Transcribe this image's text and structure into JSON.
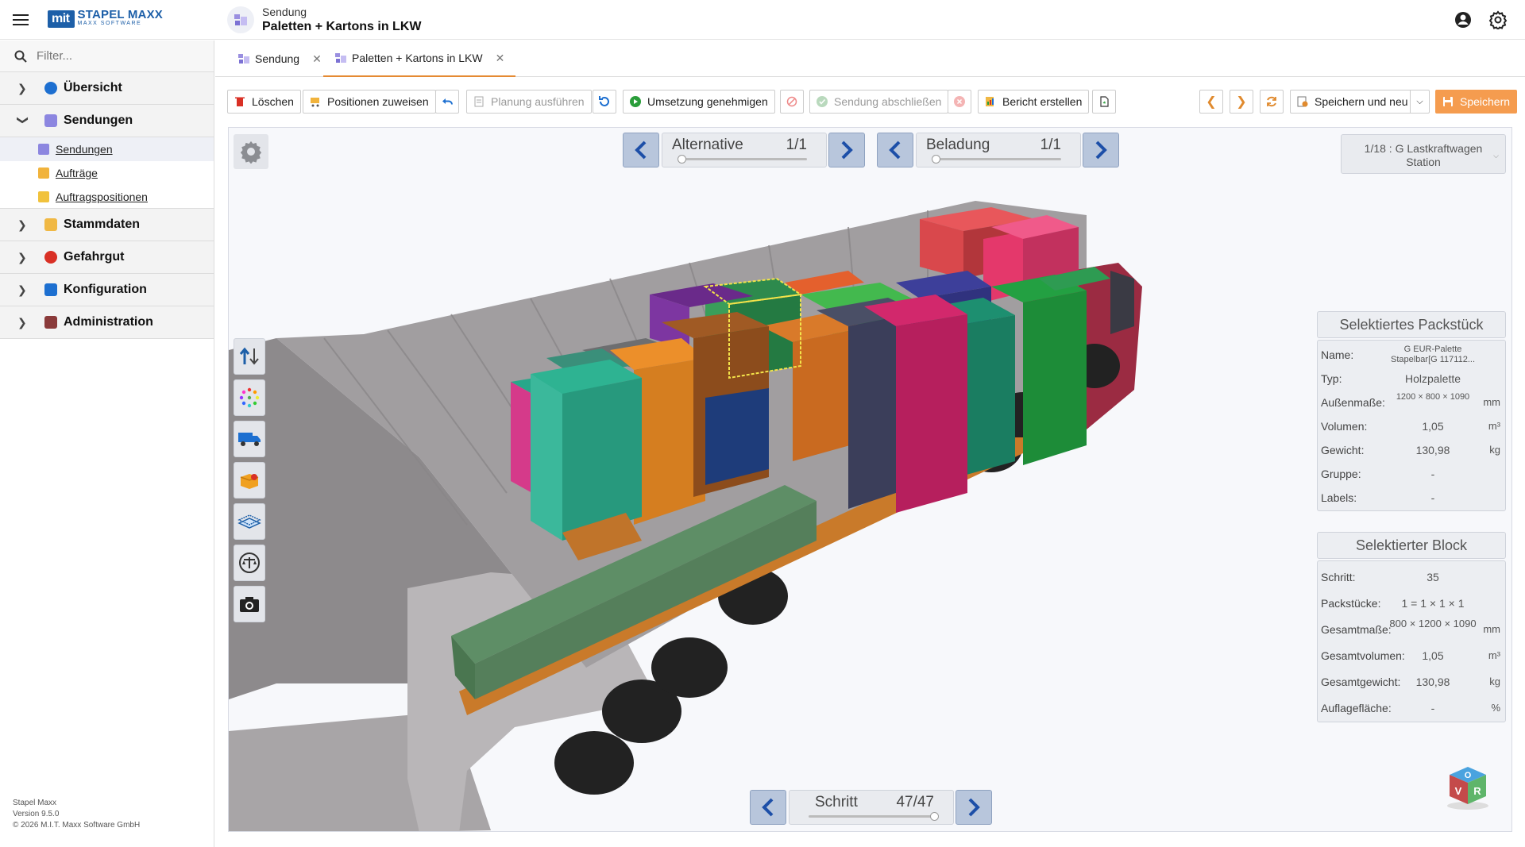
{
  "header": {
    "logo_box": "mit",
    "logo_name": "STAPEL MAXX",
    "logo_sub": "MAXX SOFTWARE",
    "breadcrumb_small": "Sendung",
    "breadcrumb_title": "Paletten + Kartons in LKW"
  },
  "sidebar": {
    "filter_placeholder": "Filter...",
    "items": [
      {
        "label": "Übersicht",
        "expanded": false,
        "icon": "globe-icon",
        "color": "#1d6fd0"
      },
      {
        "label": "Sendungen",
        "expanded": true,
        "icon": "shipment-icon",
        "color": "#6a6fd8"
      },
      {
        "label": "Stammdaten",
        "expanded": false,
        "icon": "master-data-icon",
        "color": "#e8a43a"
      },
      {
        "label": "Gefahrgut",
        "expanded": false,
        "icon": "hazard-icon",
        "color": "#d93025"
      },
      {
        "label": "Konfiguration",
        "expanded": false,
        "icon": "config-icon",
        "color": "#1d6fd0"
      },
      {
        "label": "Administration",
        "expanded": false,
        "icon": "admin-icon",
        "color": "#8a3a3a"
      }
    ],
    "sub_items": [
      {
        "label": "Sendungen",
        "active": true
      },
      {
        "label": "Aufträge",
        "active": false
      },
      {
        "label": "Auftragspositionen",
        "active": false
      }
    ],
    "footer": {
      "line1": "Stapel Maxx",
      "line2": "Version 9.5.0",
      "line3": "© 2026 M.I.T. Maxx Software GmbH"
    }
  },
  "tabs": [
    {
      "label": "Sendung",
      "active": false
    },
    {
      "label": "Paletten + Kartons in LKW",
      "active": true
    }
  ],
  "toolbar": {
    "delete": "Löschen",
    "assign_positions": "Positionen zuweisen",
    "run_planning": "Planung ausführen",
    "approve": "Umsetzung genehmigen",
    "complete": "Sendung abschließen",
    "report": "Bericht erstellen",
    "save_new": "Speichern und neu",
    "save": "Speichern",
    "accent_color": "#f59c4f"
  },
  "viewer": {
    "alternative_label": "Alternative",
    "alternative_value": "1/1",
    "loading_label": "Beladung",
    "loading_value": "1/1",
    "station_line1": "1/18 : G Lastkraftwagen",
    "station_line2": "Station",
    "step_label": "Schritt",
    "step_value": "47/47",
    "step_progress": 1.0,
    "alternative_progress": 0.0,
    "loading_progress": 0.0
  },
  "selected_package": {
    "title": "Selektiertes Packstück",
    "rows": [
      {
        "key": "Name:",
        "value": "G EUR-Palette Stapelbar[G 117112...",
        "unit": ""
      },
      {
        "key": "Typ:",
        "value": "Holzpalette",
        "unit": ""
      },
      {
        "key": "Außenmaße:",
        "value": "1200 × 800 × 1090",
        "unit": "mm"
      },
      {
        "key": "Volumen:",
        "value": "1,05",
        "unit": "m³"
      },
      {
        "key": "Gewicht:",
        "value": "130,98",
        "unit": "kg"
      },
      {
        "key": "Gruppe:",
        "value": "-",
        "unit": ""
      },
      {
        "key": "Labels:",
        "value": "-",
        "unit": ""
      }
    ]
  },
  "selected_block": {
    "title": "Selektierter Block",
    "rows": [
      {
        "key": "Schritt:",
        "value": "35",
        "unit": ""
      },
      {
        "key": "Packstücke:",
        "value": "1 = 1 × 1 × 1",
        "unit": ""
      },
      {
        "key": "Gesamtmaße:",
        "value": "800 × 1200 × 1090",
        "unit": "mm"
      },
      {
        "key": "Gesamtvolumen:",
        "value": "1,05",
        "unit": "m³"
      },
      {
        "key": "Gesamtgewicht:",
        "value": "130,98",
        "unit": "kg"
      },
      {
        "key": "Auflagefläche:",
        "value": "-",
        "unit": "%"
      }
    ]
  },
  "cube_letters": {
    "top": "O",
    "left": "V",
    "right": "R"
  }
}
